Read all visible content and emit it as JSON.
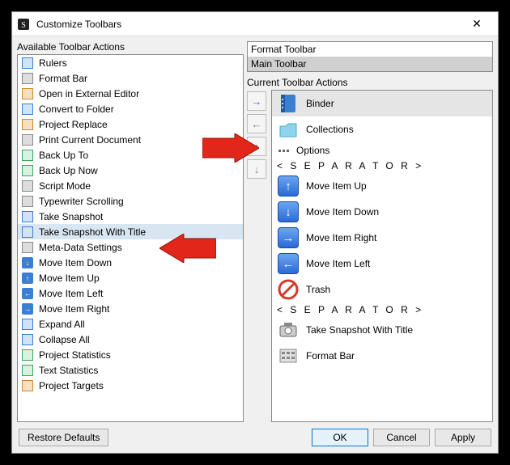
{
  "window": {
    "title": "Customize Toolbars",
    "close_glyph": "✕"
  },
  "labels": {
    "available": "Available Toolbar Actions",
    "current": "Current Toolbar Actions"
  },
  "toolbar_options": [
    {
      "label": "Format Toolbar",
      "selected": false
    },
    {
      "label": "Main Toolbar",
      "selected": true
    }
  ],
  "available_items": [
    {
      "label": "Rulers",
      "icon": "rulers",
      "cls": "c-blue"
    },
    {
      "label": "Format Bar",
      "icon": "format-bar",
      "cls": "c-gray"
    },
    {
      "label": "Open in External Editor",
      "icon": "external-editor",
      "cls": "c-orange"
    },
    {
      "label": "Convert to Folder",
      "icon": "convert-folder",
      "cls": "c-blue"
    },
    {
      "label": "Project Replace",
      "icon": "project-replace",
      "cls": "c-orange"
    },
    {
      "label": "Print Current Document",
      "icon": "print",
      "cls": "c-gray"
    },
    {
      "label": "Back Up To",
      "icon": "backup-to",
      "cls": "c-green"
    },
    {
      "label": "Back Up Now",
      "icon": "backup-now",
      "cls": "c-green"
    },
    {
      "label": "Script Mode",
      "icon": "script-mode",
      "cls": "c-gray"
    },
    {
      "label": "Typewriter Scrolling",
      "icon": "typewriter",
      "cls": "c-gray"
    },
    {
      "label": "Take Snapshot",
      "icon": "snapshot",
      "cls": "c-blue"
    },
    {
      "label": "Take Snapshot With Title",
      "icon": "snapshot-title",
      "cls": "c-blue",
      "selected": true
    },
    {
      "label": "Meta-Data Settings",
      "icon": "metadata",
      "cls": "c-gray"
    },
    {
      "label": "Move Item Down",
      "icon": "move-down",
      "arrow": "↓"
    },
    {
      "label": "Move Item Up",
      "icon": "move-up",
      "arrow": "↑"
    },
    {
      "label": "Move Item Left",
      "icon": "move-left",
      "arrow": "←"
    },
    {
      "label": "Move Item Right",
      "icon": "move-right",
      "arrow": "→"
    },
    {
      "label": "Expand All",
      "icon": "expand-all",
      "cls": "c-blue"
    },
    {
      "label": "Collapse All",
      "icon": "collapse-all",
      "cls": "c-blue"
    },
    {
      "label": "Project Statistics",
      "icon": "proj-stats",
      "cls": "c-green"
    },
    {
      "label": "Text Statistics",
      "icon": "text-stats",
      "cls": "c-green"
    },
    {
      "label": "Project Targets",
      "icon": "proj-targets",
      "cls": "c-orange"
    }
  ],
  "current_items": [
    {
      "label": "Binder",
      "type": "item",
      "icon": "binder",
      "color": "#3a7fd0",
      "selected": true
    },
    {
      "label": "Collections",
      "type": "item",
      "icon": "collections",
      "color": "#68c1e6"
    },
    {
      "label": "Options",
      "type": "item",
      "icon": "options",
      "color": "#888",
      "small": true
    },
    {
      "label": "< S E P A R A T O R >",
      "type": "sep"
    },
    {
      "label": "Move Item Up",
      "type": "item",
      "icon": "arrow-up",
      "arrow": "↑"
    },
    {
      "label": "Move Item Down",
      "type": "item",
      "icon": "arrow-down",
      "arrow": "↓"
    },
    {
      "label": "Move Item Right",
      "type": "item",
      "icon": "arrow-right",
      "arrow": "→"
    },
    {
      "label": "Move Item Left",
      "type": "item",
      "icon": "arrow-left",
      "arrow": "←"
    },
    {
      "label": "Trash",
      "type": "item",
      "icon": "trash",
      "color": "#d43a2a"
    },
    {
      "label": "< S E P A R A T O R >",
      "type": "sep"
    },
    {
      "label": "Take Snapshot With Title",
      "type": "item",
      "icon": "snapshot-title",
      "color": "#666"
    },
    {
      "label": "Format Bar",
      "type": "item",
      "icon": "format-bar",
      "color": "#888"
    }
  ],
  "move_buttons": {
    "add": "→",
    "remove": "←",
    "up": "↑",
    "down": "↓"
  },
  "footer": {
    "restore": "Restore Defaults",
    "ok": "OK",
    "cancel": "Cancel",
    "apply": "Apply"
  }
}
